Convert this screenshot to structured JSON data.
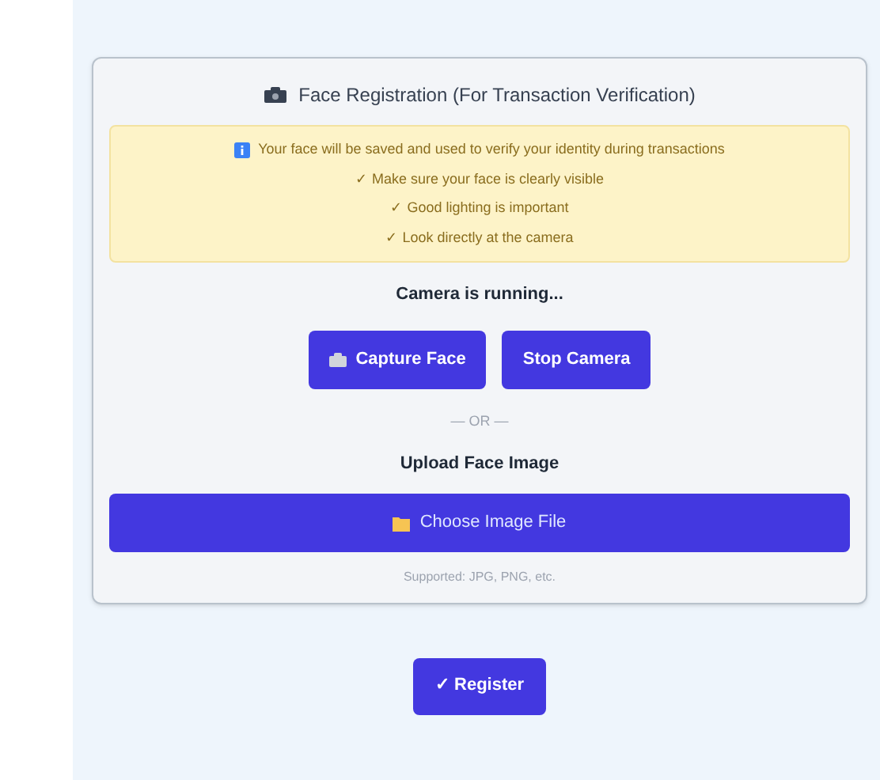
{
  "card": {
    "title": "Face Registration (For Transaction Verification)",
    "notice": {
      "lead": "Your face will be saved and used to verify your identity during transactions",
      "tips": [
        "✓ Make sure your face is clearly visible",
        "✓ Good lighting is important",
        "✓ Look directly at the camera"
      ]
    },
    "camera_status": "Camera is running...",
    "camera_buttons": [
      {
        "kind": "capture",
        "label": "Capture Face"
      },
      {
        "kind": "stop",
        "label": "Stop Camera"
      }
    ],
    "divider": "— OR —",
    "upload_heading": "Upload Face Image",
    "upload_button": "Choose Image File",
    "upload_hint": "Supported: JPG, PNG, etc."
  },
  "submit_button": "✓ Register"
}
